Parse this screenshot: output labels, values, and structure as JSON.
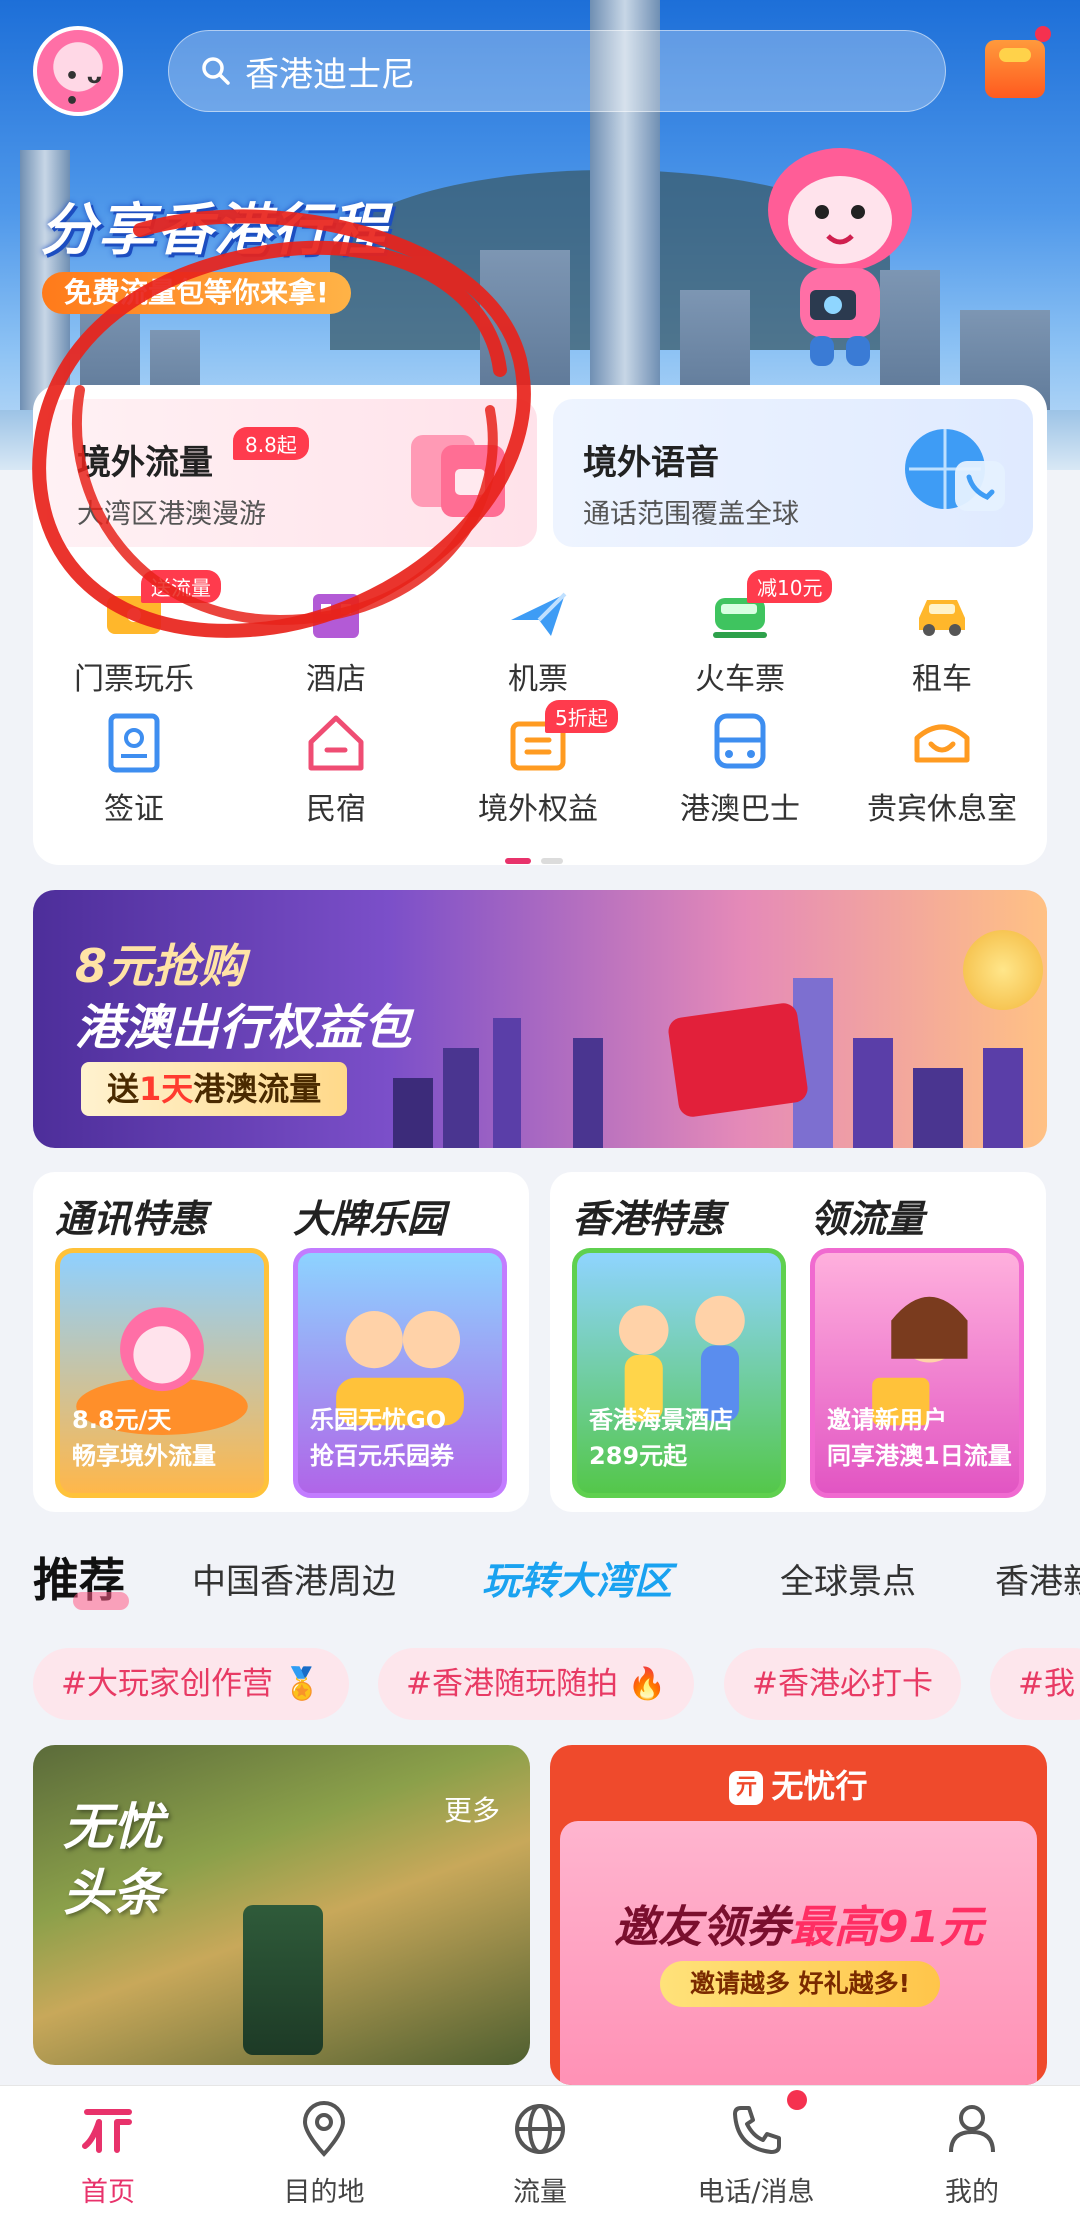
{
  "header": {
    "search_placeholder": "香港迪士尼",
    "promo_title": "分享香港行程",
    "promo_subtitle": "免费流量包等你来拿!"
  },
  "features": [
    {
      "title": "境外流量",
      "subtitle": "大湾区港澳漫游",
      "badge": "8.8起"
    },
    {
      "title": "境外语音",
      "subtitle": "通话范围覆盖全球"
    }
  ],
  "services": [
    {
      "label": "门票玩乐",
      "tag": "送流量",
      "icon": "ticket-icon"
    },
    {
      "label": "酒店",
      "icon": "hotel-icon"
    },
    {
      "label": "机票",
      "icon": "airplane-icon"
    },
    {
      "label": "火车票",
      "tag": "减10元",
      "icon": "train-icon"
    },
    {
      "label": "租车",
      "icon": "car-icon"
    },
    {
      "label": "签证",
      "icon": "visa-icon"
    },
    {
      "label": "民宿",
      "icon": "homestay-icon"
    },
    {
      "label": "境外权益",
      "tag": "5折起",
      "icon": "benefits-icon"
    },
    {
      "label": "港澳巴士",
      "icon": "bus-icon"
    },
    {
      "label": "贵宾休息室",
      "icon": "lounge-icon"
    }
  ],
  "banner": {
    "line1": "8元抢购",
    "line2": "港澳出行权益包",
    "line3_pre": "送",
    "line3_hl": "1天",
    "line3_post": "港澳流量"
  },
  "promo_cards": [
    {
      "sections": [
        {
          "title": "通讯特惠",
          "line1": "8.8元/天",
          "line2": "畅享境外流量"
        },
        {
          "title": "大牌乐园",
          "line1": "乐园无忧GO",
          "line2": "抢百元乐园券"
        }
      ]
    },
    {
      "sections": [
        {
          "title": "香港特惠",
          "line1": "香港海景酒店",
          "line2": "289元起"
        },
        {
          "title": "领流量",
          "line1": "邀请新用户",
          "line2": "同享港澳1日流量"
        }
      ]
    }
  ],
  "tabs": [
    "推荐",
    "中国香港周边",
    "玩转大湾区",
    "全球景点",
    "香港新"
  ],
  "chips": [
    "#大玩家创作营",
    "#香港随玩随拍",
    "#香港必打卡",
    "#我"
  ],
  "feed": {
    "left_title1": "无忧",
    "left_title2": "头条",
    "left_more": "更多",
    "right_brand": "无忧行",
    "right_logo_glyph": "亓",
    "right_big_pre": "邀友领券",
    "right_big_hl": "最高91元",
    "right_pill": "邀请越多 好礼越多!"
  },
  "bottom_nav": [
    {
      "label": "首页",
      "icon": "home-icon",
      "active": true
    },
    {
      "label": "目的地",
      "icon": "location-pin-icon"
    },
    {
      "label": "流量",
      "icon": "globe-icon"
    },
    {
      "label": "电话/消息",
      "icon": "phone-icon",
      "badge_dot": true
    },
    {
      "label": "我的",
      "icon": "user-icon"
    }
  ],
  "colors": {
    "accent": "#e8326b",
    "badge_red": "#ff3b4d",
    "tab_special": "#1aa2f0",
    "annotation_red": "#e8231b"
  }
}
